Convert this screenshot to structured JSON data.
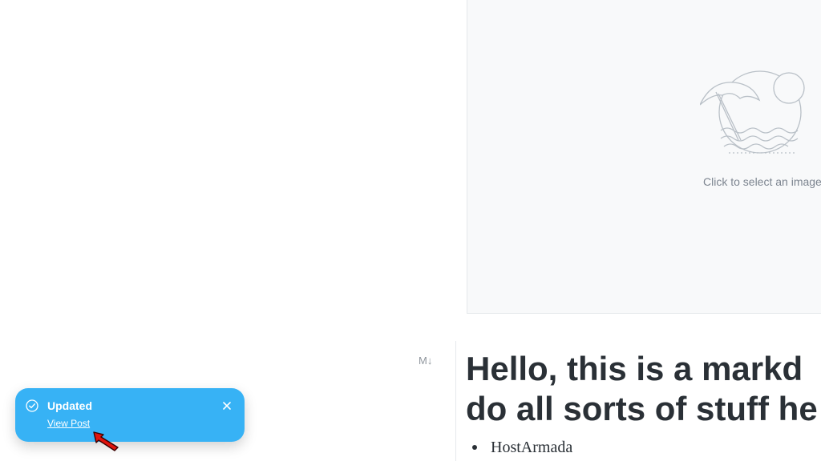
{
  "feature_image": {
    "hint": "Click to select an image",
    "icon": "beach-umbrella-illustration"
  },
  "markdown_card": {
    "label": "M↓",
    "heading_line_1": "Hello, this is a markd",
    "heading_line_2": "do all sorts of stuff he",
    "list_items": [
      "HostArmada"
    ]
  },
  "toast": {
    "title": "Updated",
    "link": "View Post",
    "icon": "check-circle-icon",
    "close_icon": "close-icon",
    "color": "#37b2f5"
  },
  "annotation": {
    "icon": "red-pointer-arrow",
    "color": "#e0140d"
  }
}
